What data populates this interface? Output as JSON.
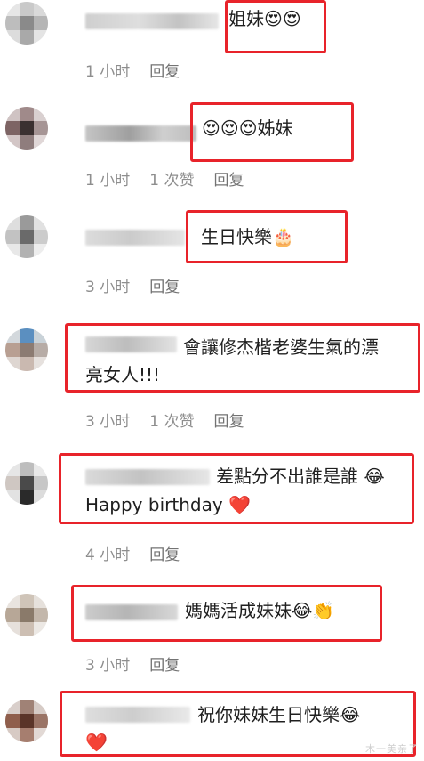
{
  "comments": [
    {
      "text": "姐妹😍😍",
      "time": "1 小时",
      "likes": "",
      "reply": "回复"
    },
    {
      "text": "😍😍😍姊妹",
      "time": "1 小时",
      "likes": "1 次赞",
      "reply": "回复"
    },
    {
      "text": "生日快樂🎂",
      "time": "3 小时",
      "likes": "",
      "reply": "回复"
    },
    {
      "text_line1": "會讓修杰楷老婆生氣的漂",
      "text_line2": "亮女人!!!",
      "time": "3 小时",
      "likes": "1 次赞",
      "reply": "回复"
    },
    {
      "text_line1": "差點分不出誰是誰 😂",
      "text_line2": "Happy birthday ❤️",
      "time": "4 小时",
      "likes": "",
      "reply": "回复"
    },
    {
      "text": "媽媽活成妹妹😂👏",
      "time": "3 小时",
      "likes": "",
      "reply": "回复"
    },
    {
      "text_line1": "祝你妹妹生日快樂😂",
      "text_line2": "❤️",
      "time": "",
      "likes": "",
      "reply": ""
    }
  ],
  "watermark": "木一美亲子"
}
